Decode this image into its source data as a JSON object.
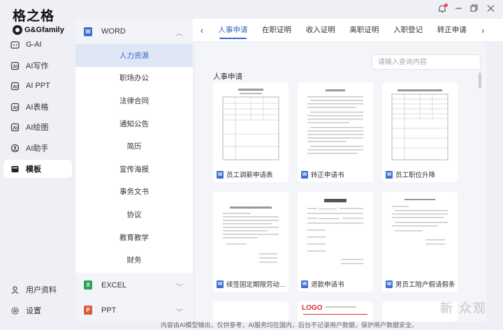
{
  "app": {
    "logo_cn": "格之格",
    "logo_en": "G&Gfamily"
  },
  "nav": {
    "items": [
      {
        "label": "G-AI",
        "icon": "gai-icon"
      },
      {
        "label": "AI写作",
        "icon": "write-icon"
      },
      {
        "label": "AI PPT",
        "icon": "ppt-icon"
      },
      {
        "label": "AI表格",
        "icon": "table-icon"
      },
      {
        "label": "AI绘图",
        "icon": "draw-icon"
      },
      {
        "label": "AI助手",
        "icon": "assistant-icon"
      },
      {
        "label": "模板",
        "icon": "template-icon",
        "active": true
      }
    ],
    "bottom": [
      {
        "label": "用户资料",
        "icon": "user-icon"
      },
      {
        "label": "设置",
        "icon": "settings-icon"
      }
    ]
  },
  "categories": {
    "word": {
      "label": "WORD",
      "badge": "W",
      "color": "#3f6fd0"
    },
    "word_items": [
      "人力资源",
      "职场办公",
      "法律合同",
      "通知公告",
      "简历",
      "宣传海报",
      "事务文书",
      "协议",
      "教育教学",
      "财务"
    ],
    "excel": {
      "label": "EXCEL",
      "badge": "X",
      "color": "#2ea05a"
    },
    "ppt": {
      "label": "PPT",
      "badge": "P",
      "color": "#e05a36"
    }
  },
  "tabs": {
    "items": [
      "人事申请",
      "在职证明",
      "收入证明",
      "离职证明",
      "入职登记",
      "转正申请"
    ],
    "active_index": 0
  },
  "search": {
    "placeholder": "请输入查询内容"
  },
  "section_title": "人事申请",
  "cards": [
    {
      "title": "员工调薪申请表",
      "thumb_heading": "员工调薪申请表"
    },
    {
      "title": "转正申请书",
      "thumb_heading": "转正申请"
    },
    {
      "title": "员工职位升降",
      "thumb_heading": "员工职位升降申请审批表"
    },
    {
      "title": "续签固定期限劳动合同...",
      "thumb_heading": "续签固定期限劳动合同通知书"
    },
    {
      "title": "退款申请书",
      "thumb_heading": "退款申请书"
    },
    {
      "title": "男员工陪产假请假条",
      "thumb_heading": "男员工陪产假请假条"
    }
  ],
  "partial_cards": [
    {
      "thumb_text": "LOGO"
    }
  ],
  "footer": "内容由AI模型输出，仅供参考，AI服务均在国内，后台不记录用户数据，保护用户数据安全。",
  "watermark": "新 众观",
  "colors": {
    "accent": "#3a66c8",
    "active_bg": "#dfe7f7",
    "notify_dot": "#e34a3a"
  }
}
